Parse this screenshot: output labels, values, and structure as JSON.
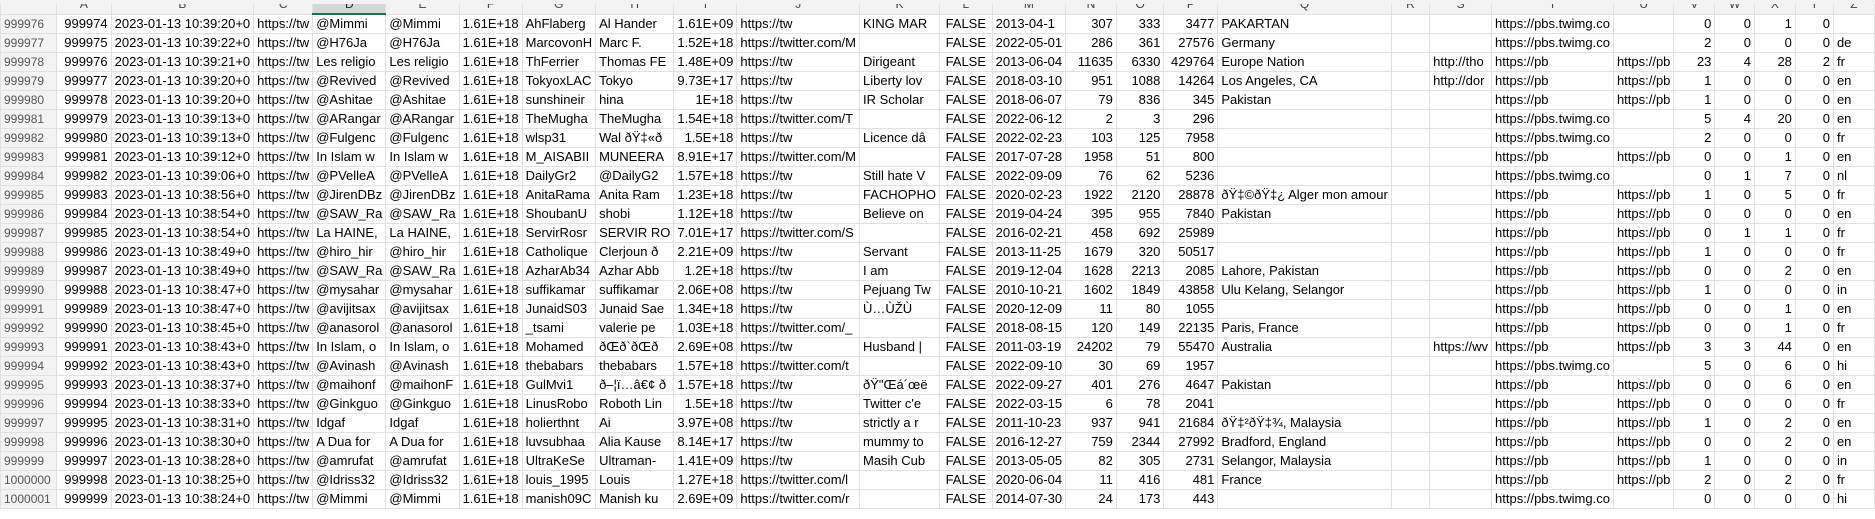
{
  "sheet": {
    "columns": [
      "A",
      "B",
      "C",
      "D",
      "E",
      "F",
      "G",
      "H",
      "I",
      "J",
      "K",
      "L",
      "M",
      "N",
      "O",
      "P",
      "Q",
      "R",
      "S",
      "T",
      "U",
      "V",
      "W",
      "X",
      "Y",
      "Z"
    ],
    "selected_column": "D",
    "rows": [
      {
        "rn": "999976",
        "cells": [
          "999974",
          "2023-01-13 10:39:20+0",
          "https://tw",
          "@Mimmi",
          "@Mimmi",
          "1.61E+18",
          "AhFlaberg",
          "Al Hander",
          "1.61E+09",
          "https://tw",
          "KING MAR",
          "FALSE",
          "2013-04-1",
          "307",
          "333",
          "3477",
          "PAKARTAN",
          "",
          "",
          "https://pbs.twimg.co",
          "",
          "0",
          "0",
          "1",
          "0",
          ""
        ]
      },
      {
        "rn": "999977",
        "cells": [
          "999975",
          "2023-01-13 10:39:22+0",
          "https://tw",
          "@H76Ja",
          "@H76Ja",
          "1.61E+18",
          "MarcovonH",
          "Marc F.",
          "1.52E+18",
          "https://twitter.com/M",
          "",
          "FALSE",
          "2022-05-01",
          "286",
          "361",
          "27576",
          "Germany",
          "",
          "",
          "https://pbs.twimg.co",
          "",
          "2",
          "0",
          "0",
          "0",
          "de"
        ]
      },
      {
        "rn": "999978",
        "cells": [
          "999976",
          "2023-01-13 10:39:21+0",
          "https://tw",
          "Les religio",
          "Les religio",
          "1.61E+18",
          "ThFerrier",
          "Thomas FE",
          "1.48E+09",
          "https://tw",
          "Dirigeant",
          "FALSE",
          "2013-06-04",
          "11635",
          "6330",
          "429764",
          "Europe Nation",
          "",
          "http://tho",
          "https://pb",
          "https://pb",
          "23",
          "4",
          "28",
          "2",
          "fr"
        ]
      },
      {
        "rn": "999979",
        "cells": [
          "999977",
          "2023-01-13 10:39:20+0",
          "https://tw",
          "@Revived",
          "@Revived",
          "1.61E+18",
          "TokyoxLAC",
          "Tokyo",
          "9.73E+17",
          "https://tw",
          "Liberty lov",
          "FALSE",
          "2018-03-10",
          "951",
          "1088",
          "14264",
          "Los Angeles, CA",
          "",
          "http://dor",
          "https://pb",
          "https://pb",
          "1",
          "0",
          "0",
          "0",
          "en"
        ]
      },
      {
        "rn": "999980",
        "cells": [
          "999978",
          "2023-01-13 10:39:20+0",
          "https://tw",
          "@Ashitae",
          "@Ashitae",
          "1.61E+18",
          "sunshineir",
          "hina",
          "1E+18",
          "https://tw",
          "IR Scholar",
          "FALSE",
          "2018-06-07",
          "79",
          "836",
          "345",
          "Pakistan",
          "",
          "",
          "https://pb",
          "https://pb",
          "1",
          "0",
          "0",
          "0",
          "en"
        ]
      },
      {
        "rn": "999981",
        "cells": [
          "999979",
          "2023-01-13 10:39:13+0",
          "https://tw",
          "@ARangar",
          "@ARangar",
          "1.61E+18",
          "TheMugha",
          "TheMugha",
          "1.54E+18",
          "https://twitter.com/T",
          "",
          "FALSE",
          "2022-06-12",
          "2",
          "3",
          "296",
          "",
          "",
          "",
          "https://pbs.twimg.co",
          "",
          "5",
          "4",
          "20",
          "0",
          "en"
        ]
      },
      {
        "rn": "999982",
        "cells": [
          "999980",
          "2023-01-13 10:39:13+0",
          "https://tw",
          "@Fulgenc",
          "@Fulgenc",
          "1.61E+18",
          "wlsp31",
          "Wal ðŸ‡«ð",
          "1.5E+18",
          "https://tw",
          "Licence dâ",
          "FALSE",
          "2022-02-23",
          "103",
          "125",
          "7958",
          "",
          "",
          "",
          "https://pbs.twimg.co",
          "",
          "2",
          "0",
          "0",
          "0",
          "fr"
        ]
      },
      {
        "rn": "999983",
        "cells": [
          "999981",
          "2023-01-13 10:39:12+0",
          "https://tw",
          "In Islam w",
          "In Islam w",
          "1.61E+18",
          "M_AISABII",
          "MUNEERA",
          "8.91E+17",
          "https://twitter.com/M",
          "",
          "FALSE",
          "2017-07-28",
          "1958",
          "51",
          "800",
          "",
          "",
          "",
          "https://pb",
          "https://pb",
          "0",
          "0",
          "1",
          "0",
          "en"
        ]
      },
      {
        "rn": "999984",
        "cells": [
          "999982",
          "2023-01-13 10:39:06+0",
          "https://tw",
          "@PVelleA",
          "@PVelleA",
          "1.61E+18",
          "DailyGr2",
          "@DailyG2",
          "1.57E+18",
          "https://tw",
          "Still hate V",
          "FALSE",
          "2022-09-09",
          "76",
          "62",
          "5236",
          "",
          "",
          "",
          "https://pbs.twimg.co",
          "",
          "0",
          "1",
          "7",
          "0",
          "nl"
        ]
      },
      {
        "rn": "999985",
        "cells": [
          "999983",
          "2023-01-13 10:38:56+0",
          "https://tw",
          "@JirenDBz",
          "@JirenDBz",
          "1.61E+18",
          "AnitaRama",
          "Anita Ram",
          "1.23E+18",
          "https://tw",
          "FACHOPHO",
          "FALSE",
          "2020-02-23",
          "1922",
          "2120",
          "28878",
          "ðŸ‡©ðŸ‡¿ Alger mon amour",
          "",
          "",
          "https://pb",
          "https://pb",
          "1",
          "0",
          "5",
          "0",
          "fr"
        ]
      },
      {
        "rn": "999986",
        "cells": [
          "999984",
          "2023-01-13 10:38:54+0",
          "https://tw",
          "@SAW_Ra",
          "@SAW_Ra",
          "1.61E+18",
          "ShoubanU",
          "shobi",
          "1.12E+18",
          "https://tw",
          "Believe on",
          "FALSE",
          "2019-04-24",
          "395",
          "955",
          "7840",
          "Pakistan",
          "",
          "",
          "https://pb",
          "https://pb",
          "0",
          "0",
          "0",
          "0",
          "en"
        ]
      },
      {
        "rn": "999987",
        "cells": [
          "999985",
          "2023-01-13 10:38:54+0",
          "https://tw",
          "La HAINE,",
          "La HAINE,",
          "1.61E+18",
          "ServirRosr",
          "SERVIR RO",
          "7.01E+17",
          "https://twitter.com/S",
          "",
          "FALSE",
          "2016-02-21",
          "458",
          "692",
          "25989",
          "",
          "",
          "",
          "https://pb",
          "https://pb",
          "0",
          "1",
          "1",
          "0",
          "fr"
        ]
      },
      {
        "rn": "999988",
        "cells": [
          "999986",
          "2023-01-13 10:38:49+0",
          "https://tw",
          "@hiro_hir",
          "@hiro_hir",
          "1.61E+18",
          "Catholique",
          "Clerjoun ð",
          "2.21E+09",
          "https://tw",
          "Servant",
          "FALSE",
          "2013-11-25",
          "1679",
          "320",
          "50517",
          "",
          "",
          "",
          "https://pb",
          "https://pb",
          "1",
          "0",
          "0",
          "0",
          "fr"
        ]
      },
      {
        "rn": "999989",
        "cells": [
          "999987",
          "2023-01-13 10:38:49+0",
          "https://tw",
          "@SAW_Ra",
          "@SAW_Ra",
          "1.61E+18",
          "AzharAb34",
          "Azhar Abb",
          "1.2E+18",
          "https://tw",
          "I am",
          "FALSE",
          "2019-12-04",
          "1628",
          "2213",
          "2085",
          "Lahore, Pakistan",
          "",
          "",
          "https://pb",
          "https://pb",
          "0",
          "0",
          "2",
          "0",
          "en"
        ]
      },
      {
        "rn": "999990",
        "cells": [
          "999988",
          "2023-01-13 10:38:47+0",
          "https://tw",
          "@mysahar",
          "@mysahar",
          "1.61E+18",
          "suffikamar",
          "suffikamar",
          "2.06E+08",
          "https://tw",
          "Pejuang Tw",
          "FALSE",
          "2010-10-21",
          "1602",
          "1849",
          "43858",
          "Ulu Kelang, Selangor",
          "",
          "",
          "https://pb",
          "https://pb",
          "1",
          "0",
          "0",
          "0",
          "in"
        ]
      },
      {
        "rn": "999991",
        "cells": [
          "999989",
          "2023-01-13 10:38:47+0",
          "https://tw",
          "@avijitsax",
          "@avijitsax",
          "1.61E+18",
          "JunaidS03",
          "Junaid Sae",
          "1.34E+18",
          "https://tw",
          "Ù…ÙŽÙ",
          "FALSE",
          "2020-12-09",
          "11",
          "80",
          "1055",
          "",
          "",
          "",
          "https://pb",
          "https://pb",
          "0",
          "0",
          "1",
          "0",
          "en"
        ]
      },
      {
        "rn": "999992",
        "cells": [
          "999990",
          "2023-01-13 10:38:45+0",
          "https://tw",
          "@anasorol",
          "@anasorol",
          "1.61E+18",
          "_tsami",
          "valerie pe",
          "1.03E+18",
          "https://twitter.com/_",
          "",
          "FALSE",
          "2018-08-15",
          "120",
          "149",
          "22135",
          "Paris, France",
          "",
          "",
          "https://pb",
          "https://pb",
          "0",
          "0",
          "1",
          "0",
          "fr"
        ]
      },
      {
        "rn": "999993",
        "cells": [
          "999991",
          "2023-01-13 10:38:43+0",
          "https://tw",
          "In Islam, o",
          "In Islam, o",
          "1.61E+18",
          "Mohamed",
          "ðŒð`ðŒð",
          "2.69E+08",
          "https://tw",
          "Husband |",
          "FALSE",
          "2011-03-19",
          "24202",
          "79",
          "55470",
          "Australia",
          "",
          "https://wv",
          "https://pb",
          "https://pb",
          "3",
          "3",
          "44",
          "0",
          "en"
        ]
      },
      {
        "rn": "999994",
        "cells": [
          "999992",
          "2023-01-13 10:38:43+0",
          "https://tw",
          "@Avinash",
          "@Avinash",
          "1.61E+18",
          "thebabars",
          "thebabars",
          "1.57E+18",
          "https://twitter.com/t",
          "",
          "FALSE",
          "2022-09-10",
          "30",
          "69",
          "1957",
          "",
          "",
          "",
          "https://pbs.twimg.co",
          "",
          "5",
          "0",
          "6",
          "0",
          "hi"
        ]
      },
      {
        "rn": "999995",
        "cells": [
          "999993",
          "2023-01-13 10:38:37+0",
          "https://tw",
          "@maihonf",
          "@maihonF",
          "1.61E+18",
          "GulMvi1",
          "ð–¦ï…â€¢ ð",
          "1.57E+18",
          "https://tw",
          "ðŸ\"Œá´œë",
          "FALSE",
          "2022-09-27",
          "401",
          "276",
          "4647",
          "Pakistan",
          "",
          "",
          "https://pb",
          "https://pb",
          "0",
          "0",
          "6",
          "0",
          "en"
        ]
      },
      {
        "rn": "999996",
        "cells": [
          "999994",
          "2023-01-13 10:38:33+0",
          "https://tw",
          "@Ginkguo",
          "@Ginkguo",
          "1.61E+18",
          "LinusRobo",
          "Roboth Lin",
          "1.5E+18",
          "https://tw",
          "Twitter c'e",
          "FALSE",
          "2022-03-15",
          "6",
          "78",
          "2041",
          "",
          "",
          "",
          "https://pb",
          "https://pb",
          "0",
          "0",
          "0",
          "0",
          "fr"
        ]
      },
      {
        "rn": "999997",
        "cells": [
          "999995",
          "2023-01-13 10:38:31+0",
          "https://tw",
          "Idgaf",
          "Idgaf",
          "1.61E+18",
          "holierthnt",
          "Ai",
          "3.97E+08",
          "https://tw",
          "strictly a r",
          "FALSE",
          "2011-10-23",
          "937",
          "941",
          "21684",
          "ðŸ‡²ðŸ‡¾, Malaysia",
          "",
          "",
          "https://pb",
          "https://pb",
          "1",
          "0",
          "2",
          "0",
          "en"
        ]
      },
      {
        "rn": "999998",
        "cells": [
          "999996",
          "2023-01-13 10:38:30+0",
          "https://tw",
          "A Dua for",
          "A Dua for",
          "1.61E+18",
          "luvsubhaa",
          "Alia Kause",
          "8.14E+17",
          "https://tw",
          "mummy to",
          "FALSE",
          "2016-12-27",
          "759",
          "2344",
          "27992",
          "Bradford, England",
          "",
          "",
          "https://pb",
          "https://pb",
          "0",
          "0",
          "2",
          "0",
          "en"
        ]
      },
      {
        "rn": "999999",
        "cells": [
          "999997",
          "2023-01-13 10:38:28+0",
          "https://tw",
          "@amrufat",
          "@amrufat",
          "1.61E+18",
          "UltraKeSe",
          "Ultraman-",
          "1.41E+09",
          "https://tw",
          "Masih Cub",
          "FALSE",
          "2013-05-05",
          "82",
          "305",
          "2731",
          "Selangor, Malaysia",
          "",
          "",
          "https://pb",
          "https://pb",
          "1",
          "0",
          "0",
          "0",
          "in"
        ]
      },
      {
        "rn": "1000000",
        "cells": [
          "999998",
          "2023-01-13 10:38:25+0",
          "https://tw",
          "@Idriss32",
          "@Idriss32",
          "1.61E+18",
          "louis_1995",
          "Louis",
          "1.27E+18",
          "https://twitter.com/l",
          "",
          "FALSE",
          "2020-06-04",
          "11",
          "416",
          "481",
          "France",
          "",
          "",
          "https://pb",
          "https://pb",
          "2",
          "0",
          "2",
          "0",
          "fr"
        ]
      },
      {
        "rn": "1000001",
        "cells": [
          "999999",
          "2023-01-13 10:38:24+0",
          "https://tw",
          "@Mimmi",
          "@Mimmi",
          "1.61E+18",
          "manish09C",
          "Manish ku",
          "2.69E+09",
          "https://twitter.com/r",
          "",
          "FALSE",
          "2014-07-30",
          "24",
          "173",
          "443",
          "",
          "",
          "",
          "https://pbs.twimg.co",
          "",
          "0",
          "0",
          "0",
          "0",
          "hi"
        ]
      }
    ]
  }
}
